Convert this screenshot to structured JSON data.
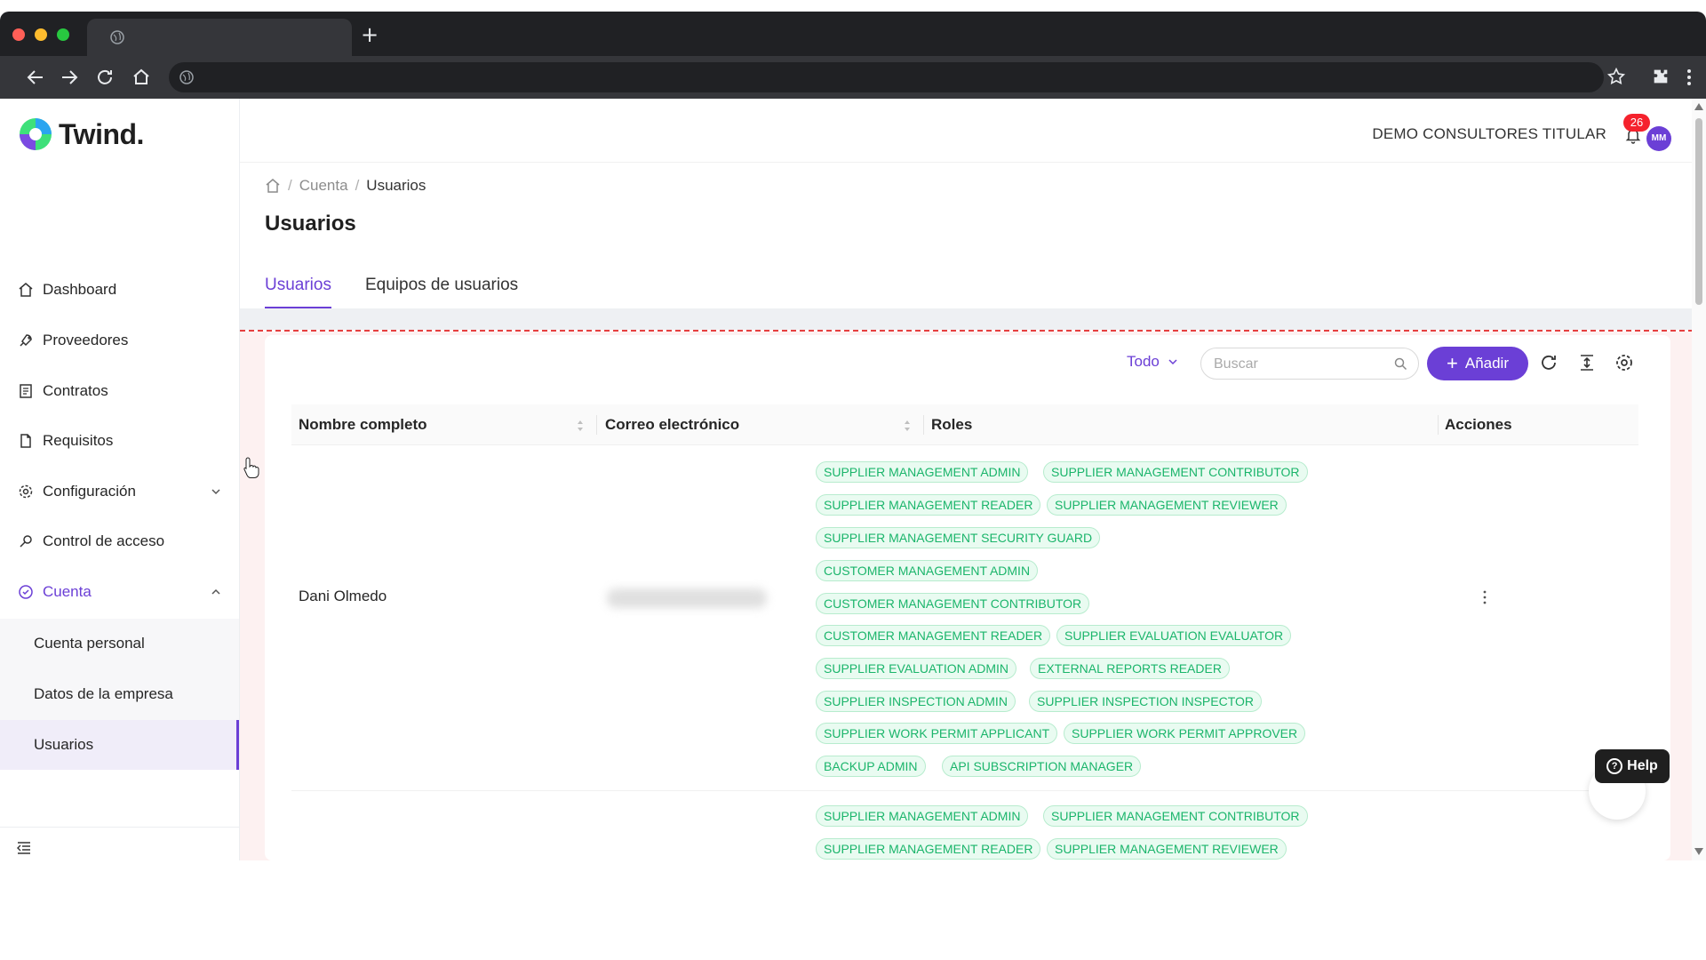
{
  "colors": {
    "accent": "#6b3fd6",
    "tag_text": "#1bb56b",
    "tag_bg": "#e9fbf1",
    "badge": "#f5222d"
  },
  "brand": {
    "name": "Twind."
  },
  "sidebar": {
    "items": [
      {
        "label": "Dashboard",
        "icon": "home-icon"
      },
      {
        "label": "Proveedores",
        "icon": "rocket-icon"
      },
      {
        "label": "Contratos",
        "icon": "contract-icon"
      },
      {
        "label": "Requisitos",
        "icon": "file-icon"
      },
      {
        "label": "Configuración",
        "icon": "gear-icon"
      },
      {
        "label": "Control de acceso",
        "icon": "key-icon"
      },
      {
        "label": "Cuenta",
        "icon": "account-icon"
      }
    ],
    "subitems": [
      {
        "label": "Cuenta personal"
      },
      {
        "label": "Datos de la empresa"
      },
      {
        "label": "Usuarios"
      }
    ]
  },
  "header": {
    "company": "DEMO CONSULTORES TITULAR",
    "notifications": "26",
    "avatar_initials": "MM"
  },
  "breadcrumb": {
    "level1": "Cuenta",
    "current": "Usuarios",
    "sep": "/"
  },
  "page": {
    "title": "Usuarios"
  },
  "tabs": [
    {
      "label": "Usuarios"
    },
    {
      "label": "Equipos de usuarios"
    }
  ],
  "toolbar": {
    "filter_label": "Todo",
    "search_placeholder": "Buscar",
    "add_label": "Añadir"
  },
  "table": {
    "columns": [
      "Nombre completo",
      "Correo electrónico",
      "Roles",
      "Acciones"
    ],
    "rows": [
      {
        "name": "Dani Olmedo",
        "roles": [
          "SUPPLIER MANAGEMENT ADMIN",
          "SUPPLIER MANAGEMENT CONTRIBUTOR",
          "SUPPLIER MANAGEMENT READER",
          "SUPPLIER MANAGEMENT REVIEWER",
          "SUPPLIER MANAGEMENT SECURITY GUARD",
          "CUSTOMER MANAGEMENT ADMIN",
          "CUSTOMER MANAGEMENT CONTRIBUTOR",
          "CUSTOMER MANAGEMENT READER",
          "SUPPLIER EVALUATION EVALUATOR",
          "SUPPLIER EVALUATION ADMIN",
          "EXTERNAL REPORTS READER",
          "SUPPLIER INSPECTION ADMIN",
          "SUPPLIER INSPECTION INSPECTOR",
          "SUPPLIER WORK PERMIT APPLICANT",
          "SUPPLIER WORK PERMIT APPROVER",
          "BACKUP ADMIN",
          "API SUBSCRIPTION MANAGER"
        ]
      },
      {
        "name": "",
        "roles": [
          "SUPPLIER MANAGEMENT ADMIN",
          "SUPPLIER MANAGEMENT CONTRIBUTOR",
          "SUPPLIER MANAGEMENT READER",
          "SUPPLIER MANAGEMENT REVIEWER"
        ]
      }
    ]
  },
  "help": {
    "label": "Help",
    "q": "?"
  }
}
